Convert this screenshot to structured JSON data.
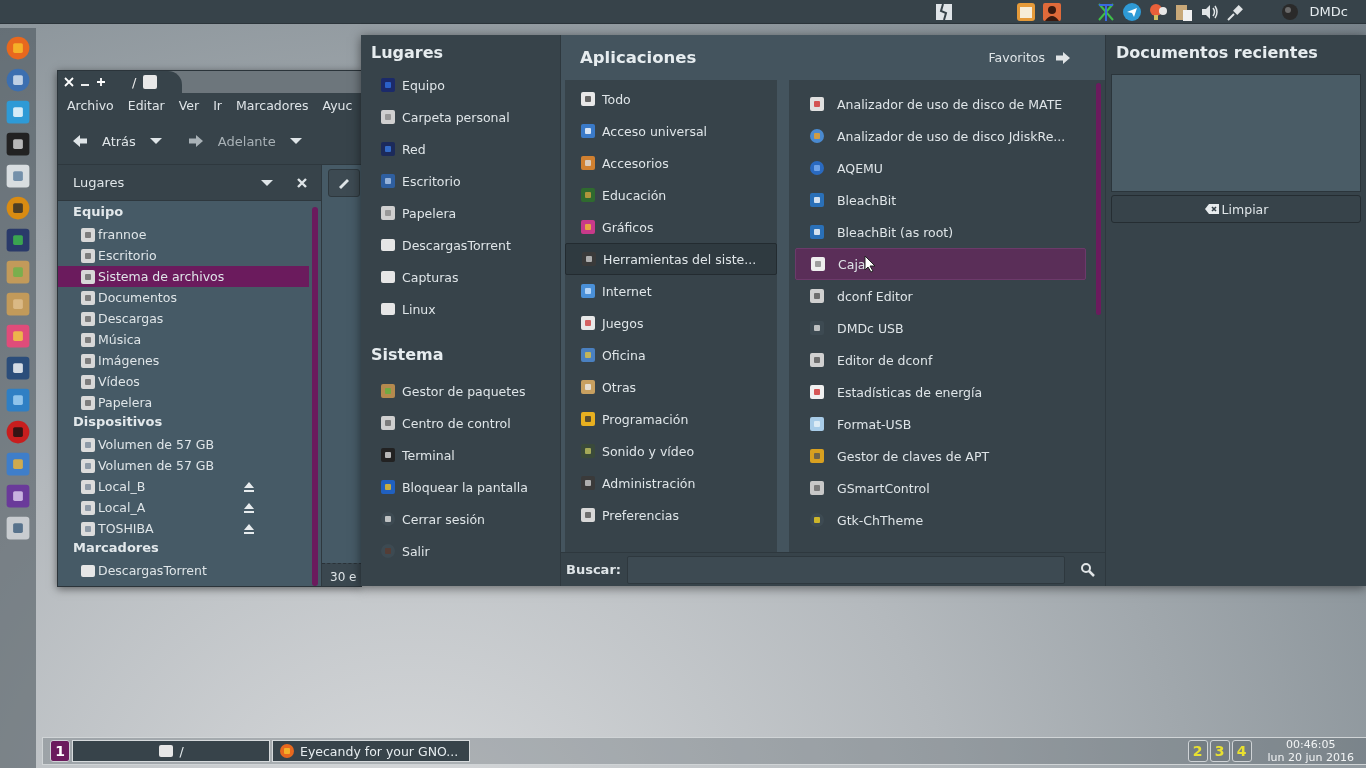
{
  "top_panel": {
    "user": "DMDc"
  },
  "file_manager": {
    "title": "/",
    "menu": [
      "Archivo",
      "Editar",
      "Ver",
      "Ir",
      "Marcadores",
      "Ayuc"
    ],
    "back": "Atrás",
    "forward": "Adelante",
    "sidebar": {
      "title": "Lugares",
      "sections": [
        {
          "heading": "Equipo",
          "items": [
            {
              "label": "frannoe",
              "selected": false,
              "eject": false
            },
            {
              "label": "Escritorio",
              "selected": false,
              "eject": false
            },
            {
              "label": "Sistema de archivos",
              "selected": true,
              "eject": false
            },
            {
              "label": "Documentos",
              "selected": false,
              "eject": false
            },
            {
              "label": "Descargas",
              "selected": false,
              "eject": false
            },
            {
              "label": "Música",
              "selected": false,
              "eject": false
            },
            {
              "label": "Imágenes",
              "selected": false,
              "eject": false
            },
            {
              "label": "Vídeos",
              "selected": false,
              "eject": false
            },
            {
              "label": "Papelera",
              "selected": false,
              "eject": false
            }
          ]
        },
        {
          "heading": "Dispositivos",
          "items": [
            {
              "label": "Volumen de 57 GB",
              "selected": false,
              "eject": false
            },
            {
              "label": "Volumen de 57 GB",
              "selected": false,
              "eject": false
            },
            {
              "label": "Local_B",
              "selected": false,
              "eject": true
            },
            {
              "label": "Local_A",
              "selected": false,
              "eject": true
            },
            {
              "label": "TOSHIBA",
              "selected": false,
              "eject": true
            }
          ]
        },
        {
          "heading": "Marcadores",
          "items": [
            {
              "label": "DescargasTorrent",
              "selected": false,
              "eject": false
            }
          ]
        }
      ]
    },
    "status": "30 e"
  },
  "menu": {
    "places": {
      "heading": "Lugares",
      "items": [
        "Equipo",
        "Carpeta personal",
        "Red",
        "Escritorio",
        "Papelera",
        "DescargasTorrent",
        "Capturas",
        "Linux"
      ]
    },
    "system": {
      "heading": "Sistema",
      "items": [
        "Gestor de paquetes",
        "Centro de control",
        "Terminal",
        "Bloquear la pantalla",
        "Cerrar sesión",
        "Salir"
      ]
    },
    "applications": {
      "heading": "Aplicaciones",
      "favorites": "Favoritos",
      "categories": [
        {
          "label": "Todo",
          "selected": false
        },
        {
          "label": "Acceso universal",
          "selected": false
        },
        {
          "label": "Accesorios",
          "selected": false
        },
        {
          "label": "Educación",
          "selected": false
        },
        {
          "label": "Gráficos",
          "selected": false
        },
        {
          "label": "Herramientas del siste...",
          "selected": true
        },
        {
          "label": "Internet",
          "selected": false
        },
        {
          "label": "Juegos",
          "selected": false
        },
        {
          "label": "Oficina",
          "selected": false
        },
        {
          "label": "Otras",
          "selected": false
        },
        {
          "label": "Programación",
          "selected": false
        },
        {
          "label": "Sonido y vídeo",
          "selected": false
        },
        {
          "label": "Administración",
          "selected": false
        },
        {
          "label": "Preferencias",
          "selected": false
        }
      ],
      "apps": [
        {
          "label": "Analizador de uso de disco de MATE",
          "selected": false
        },
        {
          "label": "Analizador de uso de disco JdiskRe...",
          "selected": false
        },
        {
          "label": "AQEMU",
          "selected": false
        },
        {
          "label": "BleachBit",
          "selected": false
        },
        {
          "label": "BleachBit (as root)",
          "selected": false
        },
        {
          "label": "Caja",
          "selected": true
        },
        {
          "label": "dconf Editor",
          "selected": false
        },
        {
          "label": "DMDc USB",
          "selected": false
        },
        {
          "label": "Editor de dconf",
          "selected": false
        },
        {
          "label": "Estadísticas de energía",
          "selected": false
        },
        {
          "label": "Format-USB",
          "selected": false
        },
        {
          "label": "Gestor de claves de APT",
          "selected": false
        },
        {
          "label": "GSmartControl",
          "selected": false
        },
        {
          "label": "Gtk-ChTheme",
          "selected": false
        }
      ]
    },
    "search": {
      "label": "Buscar:"
    },
    "recent": {
      "heading": "Documentos recientes",
      "clear": "Limpiar"
    }
  },
  "taskbar": {
    "workspaces": [
      {
        "label": "1",
        "selected": true
      },
      {
        "label": "2",
        "selected": false
      },
      {
        "label": "3",
        "selected": false
      },
      {
        "label": "4",
        "selected": false
      }
    ],
    "tasks": [
      {
        "label": "/"
      },
      {
        "label": "Eyecandy for your GNO..."
      }
    ],
    "clock": {
      "time": "00:46:05",
      "date": "lun 20 jun 2016"
    }
  }
}
